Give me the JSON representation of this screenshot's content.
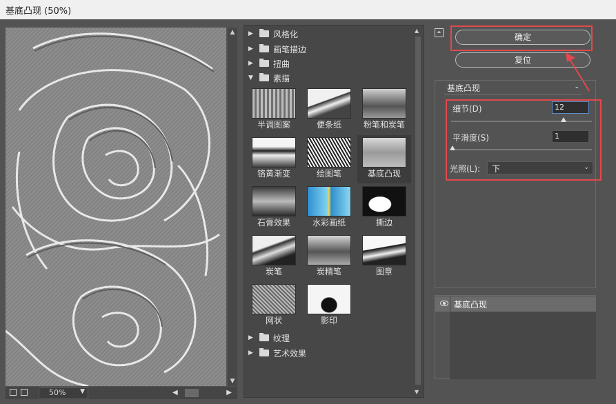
{
  "window": {
    "title": "基底凸现 (50%)"
  },
  "preview": {
    "zoom": "50%"
  },
  "filter_gallery": {
    "folders_top": [
      {
        "label": "风格化",
        "expanded": false
      },
      {
        "label": "画笔描边",
        "expanded": false
      },
      {
        "label": "扭曲",
        "expanded": false
      },
      {
        "label": "素描",
        "expanded": true
      }
    ],
    "sketch_filters": [
      "半调图案",
      "便条纸",
      "粉笔和炭笔",
      "铬黄渐变",
      "绘图笔",
      "基底凸现",
      "石膏效果",
      "水彩画纸",
      "撕边",
      "炭笔",
      "炭精笔",
      "图章",
      "网状",
      "影印"
    ],
    "selected": "基底凸现",
    "folders_bottom": [
      {
        "label": "纹理",
        "expanded": false
      },
      {
        "label": "艺术效果",
        "expanded": false
      }
    ]
  },
  "buttons": {
    "ok": "确定",
    "reset": "复位"
  },
  "settings": {
    "filter": "基底凸现",
    "detail_label": "细节(D)",
    "detail_value": "12",
    "detail_fraction": 0.8,
    "smoothness_label": "平滑度(S)",
    "smoothness_value": "1",
    "smoothness_fraction": 0.0,
    "light_label": "光照(L):",
    "light_value": "下"
  },
  "layers": [
    {
      "name": "基底凸现",
      "visible": true
    }
  ],
  "colors": {
    "highlight": "#e3484c",
    "background": "#535353"
  }
}
